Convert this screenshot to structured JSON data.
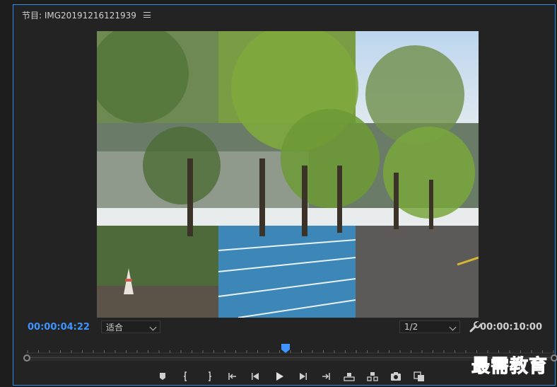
{
  "panel": {
    "title": "节目: IMG20191216121939",
    "menu_icon": "hamburger-menu-icon"
  },
  "timecode": {
    "current": "00:00:04:22",
    "duration": "00:00:10:00"
  },
  "zoom_select": {
    "value": "适合"
  },
  "resolution_select": {
    "value": "1/2"
  },
  "playhead": {
    "position_fraction": 0.49
  },
  "controls": [
    {
      "name": "add-marker-button",
      "icon": "marker-icon"
    },
    {
      "name": "mark-in-button",
      "icon": "mark-in-icon"
    },
    {
      "name": "mark-out-button",
      "icon": "mark-out-icon"
    },
    {
      "name": "go-to-in-button",
      "icon": "go-to-in-icon"
    },
    {
      "name": "step-back-button",
      "icon": "step-back-icon"
    },
    {
      "name": "play-button",
      "icon": "play-icon"
    },
    {
      "name": "step-forward-button",
      "icon": "step-forward-icon"
    },
    {
      "name": "go-to-out-button",
      "icon": "go-to-out-icon"
    },
    {
      "name": "lift-button",
      "icon": "lift-icon"
    },
    {
      "name": "extract-button",
      "icon": "extract-icon"
    },
    {
      "name": "export-frame-button",
      "icon": "camera-icon"
    },
    {
      "name": "comparison-view-button",
      "icon": "compare-icon"
    }
  ],
  "watermark": {
    "text": "最需教育"
  },
  "colors": {
    "accent": "#3e95ff",
    "panel_border": "#2d8ceb",
    "watermark": "#2b3cff"
  }
}
